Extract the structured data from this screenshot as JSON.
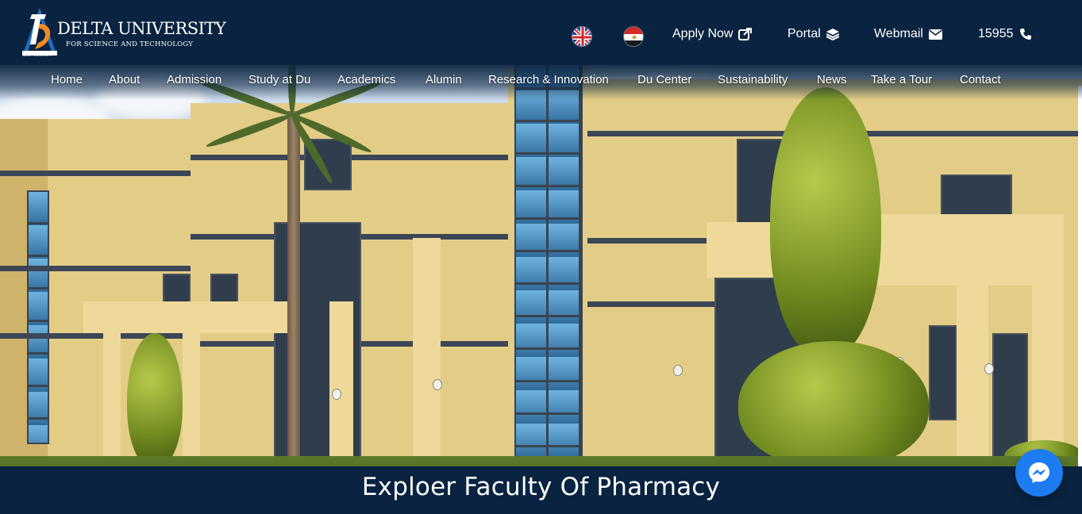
{
  "brand": {
    "name": "DELTA UNIVERSITY",
    "tagline": "FOR SCIENCE AND TECHNOLOGY",
    "mark_caption": "DELTA UNIVERSITY",
    "colors": {
      "navy": "#0a2340",
      "accent_orange": "#f08a24",
      "accent_blue": "#1e7cf2"
    }
  },
  "languages": [
    {
      "code": "en",
      "icon": "uk-flag-icon"
    },
    {
      "code": "ar",
      "icon": "egypt-flag-icon"
    }
  ],
  "top_links": {
    "apply": {
      "label": "Apply Now",
      "icon": "external-link-icon"
    },
    "portal": {
      "label": "Portal",
      "icon": "layers-icon"
    },
    "webmail": {
      "label": "Webmail",
      "icon": "envelope-icon"
    },
    "hotline": {
      "label": "15955",
      "icon": "phone-icon"
    }
  },
  "nav": [
    "Home",
    "About",
    "Admission",
    "Study at Du",
    "Academics",
    "Alumin",
    "Research & Innovation",
    "Du Center",
    "Sustainability",
    "News",
    "Take a Tour",
    "Contact"
  ],
  "hero": {
    "caption": "Exploer Faculty Of Pharmacy"
  },
  "chat": {
    "icon": "messenger-icon"
  }
}
